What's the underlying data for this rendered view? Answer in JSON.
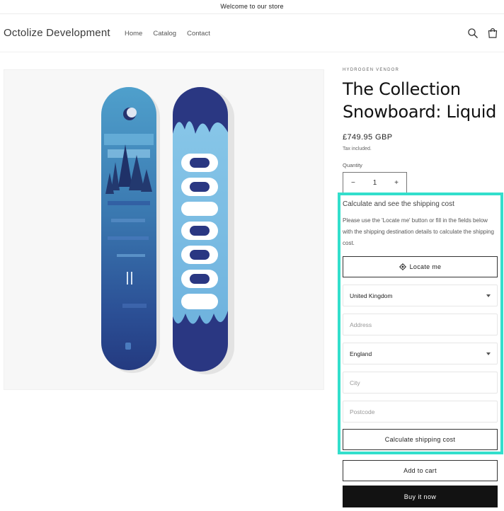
{
  "announcement": "Welcome to our store",
  "header": {
    "brand": "Octolize Development",
    "nav": [
      "Home",
      "Catalog",
      "Contact"
    ],
    "icons": [
      "search-icon",
      "cart-icon"
    ]
  },
  "product": {
    "vendor": "HYDROGEN VENDOR",
    "title": "The Collection Snowboard: Liquid",
    "price": "£749.95 GBP",
    "tax_note": "Tax included.",
    "quantity_label": "Quantity",
    "quantity": "1",
    "decrement": "−",
    "increment": "+"
  },
  "shipping": {
    "title": "Calculate and see the shipping cost",
    "description": "Please use the 'Locate me' button or fill in the fields below with the shipping destination details to calculate the shipping cost.",
    "locate_label": "Locate me",
    "country": "United Kingdom",
    "address_placeholder": "Address",
    "region": "England",
    "city_placeholder": "City",
    "postcode_placeholder": "Postcode",
    "calculate_label": "Calculate shipping cost",
    "highlight_color": "#33dfcc"
  },
  "actions": {
    "add_to_cart": "Add to cart",
    "buy_now": "Buy it now"
  }
}
